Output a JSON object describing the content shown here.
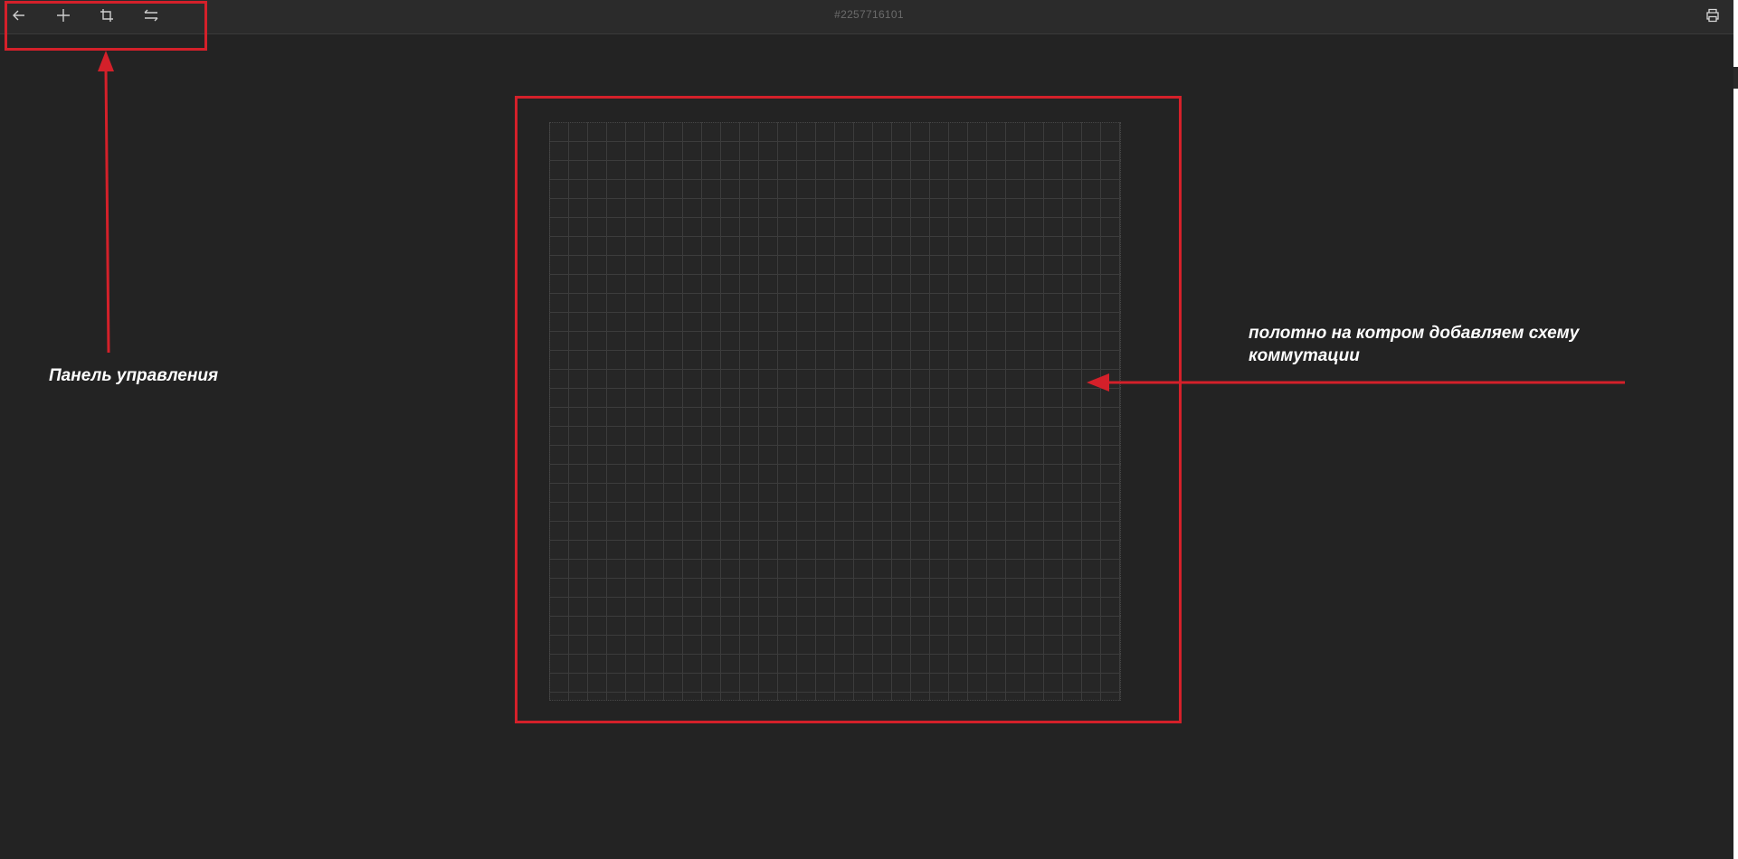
{
  "toolbar": {
    "buttons": [
      {
        "name": "back",
        "icon": "arrow-left-icon"
      },
      {
        "name": "add",
        "icon": "plus-icon"
      },
      {
        "name": "crop",
        "icon": "crop-icon"
      },
      {
        "name": "swap",
        "icon": "swap-arrows-icon"
      }
    ],
    "print_icon": "printer-icon"
  },
  "header": {
    "doc_id": "#2257716101"
  },
  "annotations": {
    "control_panel_label": "Панель управления",
    "canvas_label": "полотно на котром добавляем схему коммутации",
    "color": "#d4202a"
  },
  "canvas": {
    "grid_color": "#3c3c3c",
    "background": "#232323"
  }
}
